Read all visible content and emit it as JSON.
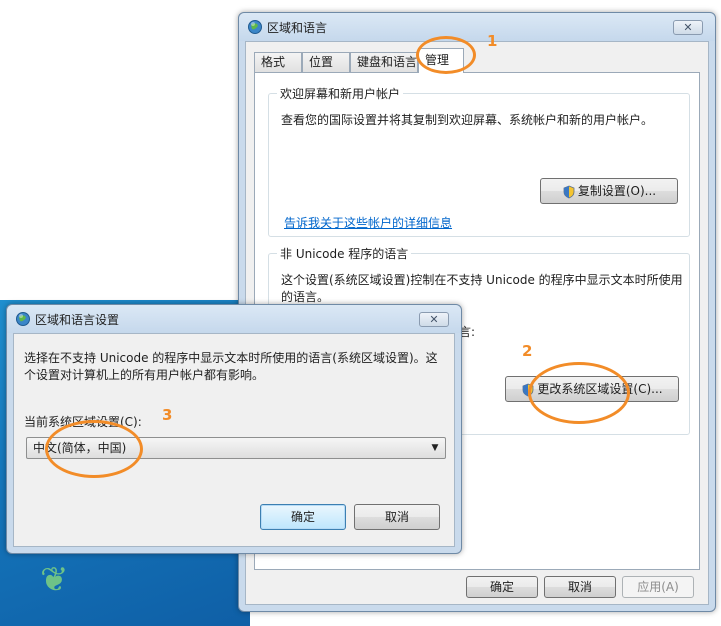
{
  "main_window": {
    "title": "区域和语言",
    "close_label": "✕",
    "tabs": [
      {
        "label": "格式"
      },
      {
        "label": "位置"
      },
      {
        "label": "键盘和语言"
      },
      {
        "label": "管理"
      }
    ],
    "welcome_group": {
      "label": "欢迎屏幕和新用户帐户",
      "description": "查看您的国际设置并将其复制到欢迎屏幕、系统帐户和新的用户帐户。",
      "copy_button": "复制设置(O)...",
      "details_link": "告诉我关于这些帐户的详细信息"
    },
    "unicode_group": {
      "label": "非 Unicode 程序的语言",
      "description": "这个设置(系统区域设置)控制在不支持 Unicode 的程序中显示文本时所使用的语言。",
      "current_label_fragment": "言:",
      "change_button": "更改系统区域设置(C)..."
    },
    "buttons": {
      "ok": "确定",
      "cancel": "取消",
      "apply": "应用(A)"
    }
  },
  "dialog": {
    "title": "区域和语言设置",
    "close_label": "✕",
    "description": "选择在不支持 Unicode 的程序中显示文本时所使用的语言(系统区域设置)。这个设置对计算机上的所有用户帐户都有影响。",
    "current_locale_label": "当前系统区域设置(C):",
    "current_locale_value": "中文(简体，中国)",
    "ok": "确定",
    "cancel": "取消"
  },
  "annotations": {
    "step1": "1",
    "step2": "2",
    "step3": "3",
    "color": "#f28c28"
  }
}
